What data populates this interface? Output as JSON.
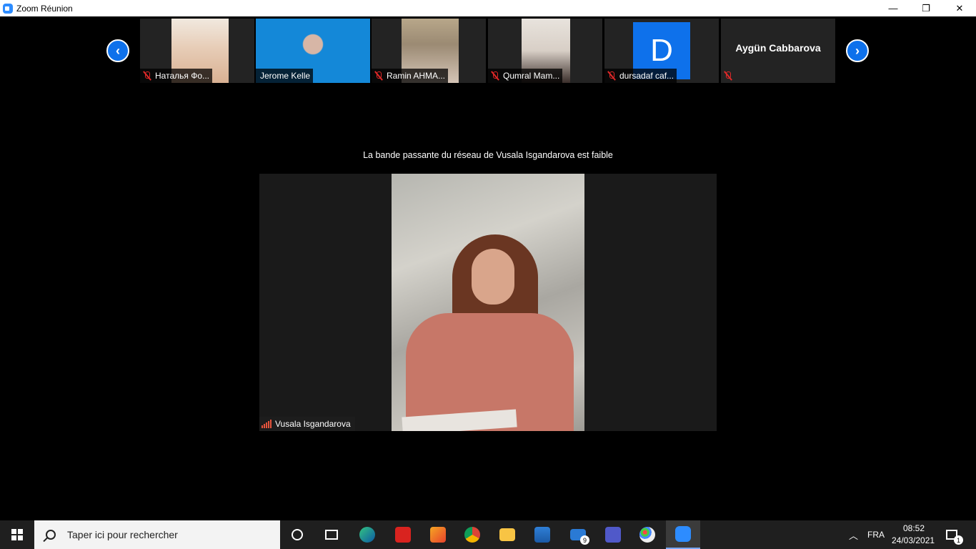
{
  "window": {
    "title": "Zoom Réunion",
    "minimize_glyph": "—",
    "restore_glyph": "❐",
    "close_glyph": "✕"
  },
  "gallery": {
    "prev_icon": "chevron-left-icon",
    "next_icon": "chevron-right-icon",
    "participants": [
      {
        "name": "Наталья Фо...",
        "muted": true,
        "tile": "video"
      },
      {
        "name": "Jerome Kelle",
        "muted": false,
        "tile": "video"
      },
      {
        "name": "Ramin AHMA...",
        "muted": true,
        "tile": "video"
      },
      {
        "name": "Qumral Mam...",
        "muted": true,
        "tile": "video"
      },
      {
        "name": "dursadaf caf...",
        "muted": true,
        "tile": "avatar",
        "avatar_letter": "D"
      },
      {
        "name": "Aygün Cabbarova",
        "muted": true,
        "tile": "name-only"
      }
    ]
  },
  "speaker": {
    "bandwidth_message": "La bande passante du réseau de Vusala Isgandarova est faible",
    "name": "Vusala Isgandarova",
    "signal_color": "#e5533c"
  },
  "taskbar": {
    "search_placeholder": "Taper ici pour rechercher",
    "apps": [
      "cortana-icon",
      "task-view-icon",
      "edge-icon",
      "acrobat-icon",
      "office-icon",
      "chrome-icon",
      "file-explorer-icon",
      "photos-icon",
      "mail-icon",
      "teams-icon",
      "paint-icon",
      "zoom-icon"
    ],
    "mail_badge": "9",
    "language": "FRA",
    "time": "08:52",
    "date": "24/03/2021",
    "notification_badge": "1"
  },
  "colors": {
    "zoom_blue": "#0e71eb",
    "mute_red": "#e02828"
  }
}
